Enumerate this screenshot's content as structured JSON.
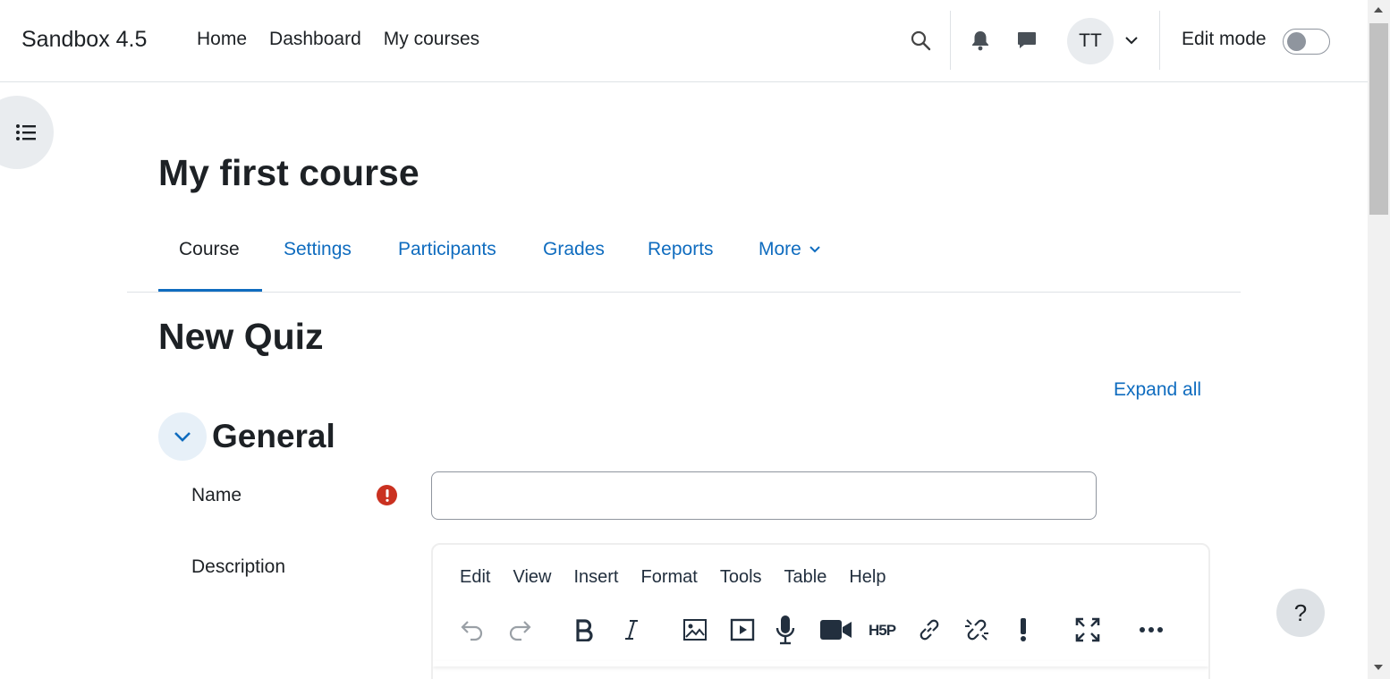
{
  "navbar": {
    "brand": "Sandbox 4.5",
    "links": [
      "Home",
      "Dashboard",
      "My courses"
    ],
    "avatar_initials": "TT",
    "edit_mode_label": "Edit mode",
    "edit_mode_on": false
  },
  "course": {
    "title": "My first course",
    "tabs": {
      "course": "Course",
      "settings": "Settings",
      "participants": "Participants",
      "grades": "Grades",
      "reports": "Reports",
      "more": "More"
    }
  },
  "page": {
    "heading": "New Quiz",
    "expand_all": "Expand all"
  },
  "general": {
    "title": "General",
    "name_label": "Name",
    "name_value": "",
    "description_label": "Description"
  },
  "editor": {
    "menu": [
      "Edit",
      "View",
      "Insert",
      "Format",
      "Tools",
      "Table",
      "Help"
    ],
    "toolbar": [
      "undo-icon",
      "redo-icon",
      "bold-icon",
      "italic-icon",
      "image-icon",
      "media-icon",
      "microphone-icon",
      "video-camera-icon",
      "h5p-icon",
      "link-icon",
      "unlink-icon",
      "accessibility-checker-icon",
      "fullscreen-icon",
      "more-icon"
    ]
  },
  "help": {
    "label": "?"
  },
  "colors": {
    "brand_blue": "#0f6cbf",
    "text": "#1d2125",
    "required_red": "#ca3120"
  }
}
